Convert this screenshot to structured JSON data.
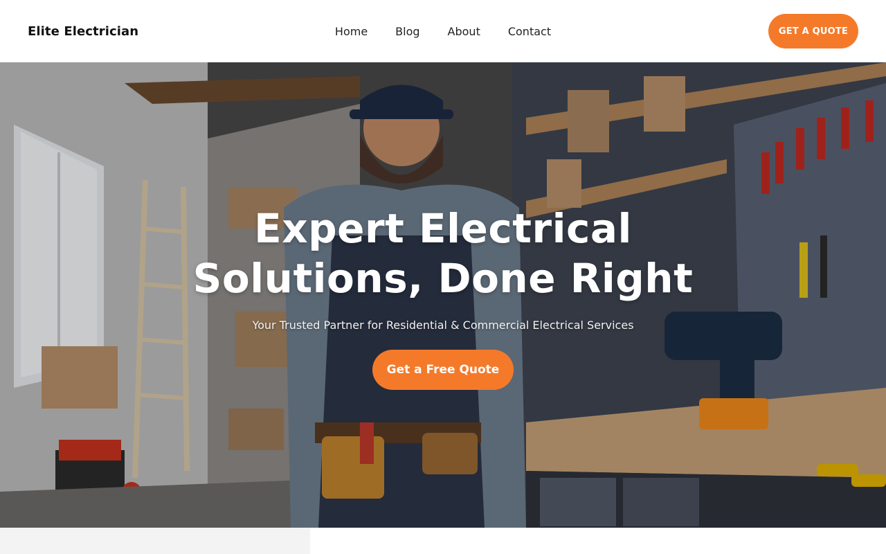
{
  "header": {
    "brand": "Elite Electrician",
    "nav": [
      {
        "label": "Home"
      },
      {
        "label": "Blog"
      },
      {
        "label": "About"
      },
      {
        "label": "Contact"
      }
    ],
    "cta_label": "GET A QUOTE"
  },
  "hero": {
    "title_line1": "Expert Electrical",
    "title_line2": "Solutions, Done Right",
    "subtitle": "Your Trusted Partner for Residential & Commercial Electrical Services",
    "button_label": "Get a Free Quote"
  },
  "colors": {
    "accent": "#f47a2a",
    "header_bg": "#ffffff",
    "text": "#111111"
  }
}
